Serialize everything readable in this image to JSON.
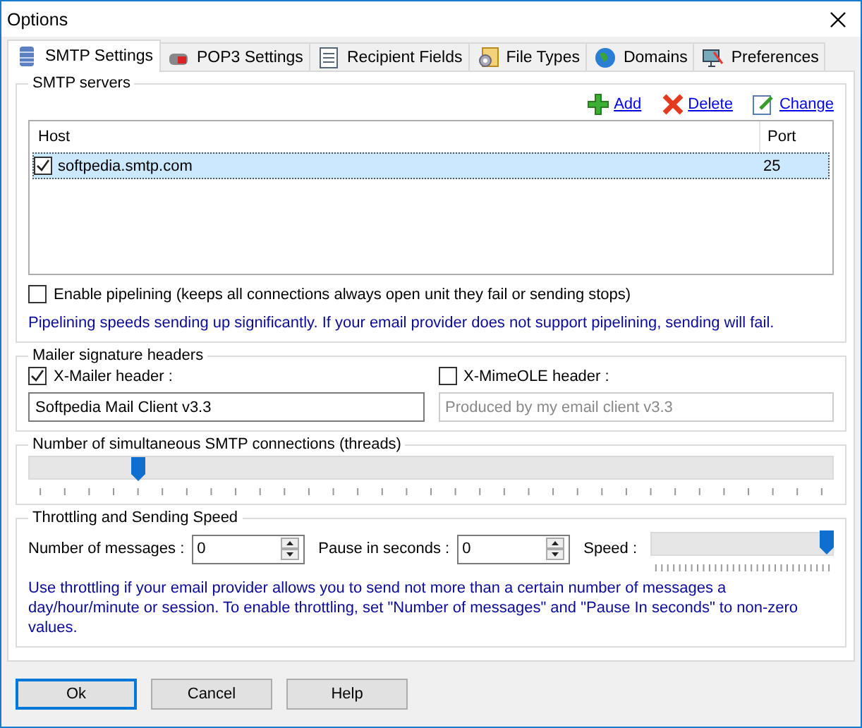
{
  "window": {
    "title": "Options"
  },
  "tabs": [
    {
      "label": "SMTP Settings",
      "selected": true
    },
    {
      "label": "POP3 Settings",
      "selected": false
    },
    {
      "label": "Recipient Fields",
      "selected": false
    },
    {
      "label": "File Types",
      "selected": false
    },
    {
      "label": "Domains",
      "selected": false
    },
    {
      "label": "Preferences",
      "selected": false
    }
  ],
  "smtp_servers": {
    "title": "SMTP servers",
    "actions": [
      {
        "label": "Add"
      },
      {
        "label": "Delete"
      },
      {
        "label": "Change"
      }
    ],
    "columns": [
      "Host",
      "Port"
    ],
    "rows": [
      {
        "host": "softpedia.smtp.com",
        "port": "25",
        "checked": true,
        "selected": true
      }
    ]
  },
  "pipelining": {
    "label": "Enable pipelining (keeps all connections always open unit they fail or sending stops)",
    "checked": false,
    "note": "Pipelining speeds sending up significantly. If your email provider does not support pipelining, sending will fail."
  },
  "mailer_headers": {
    "title": "Mailer signature headers",
    "fields": [
      {
        "label": "X-Mailer header :",
        "checked": true,
        "value": "Softpedia Mail Client v3.3",
        "disabled": false
      },
      {
        "label": "X-MimeOLE header :",
        "checked": false,
        "value": "Produced by my email client v3.3",
        "disabled": true
      }
    ]
  },
  "threads": {
    "title": "Number of simultaneous SMTP connections (threads)",
    "level": 0.13
  },
  "throttling": {
    "title": "Throttling and Sending Speed",
    "messages": {
      "label": "Number of messages :",
      "value": "0"
    },
    "pause": {
      "label": "Pause in seconds :",
      "value": "0"
    },
    "speed": {
      "label": "Speed :",
      "level": 1
    },
    "note": "Use throttling if your email provider allows you to send not more than a certain number of messages a day/hour/minute or session. To enable throttling, set \"Number of messages\" and \"Pause In seconds\" to non-zero values."
  },
  "buttons": [
    {
      "label": "Ok",
      "default": true
    },
    {
      "label": "Cancel",
      "default": false
    },
    {
      "label": "Help",
      "default": false
    }
  ]
}
